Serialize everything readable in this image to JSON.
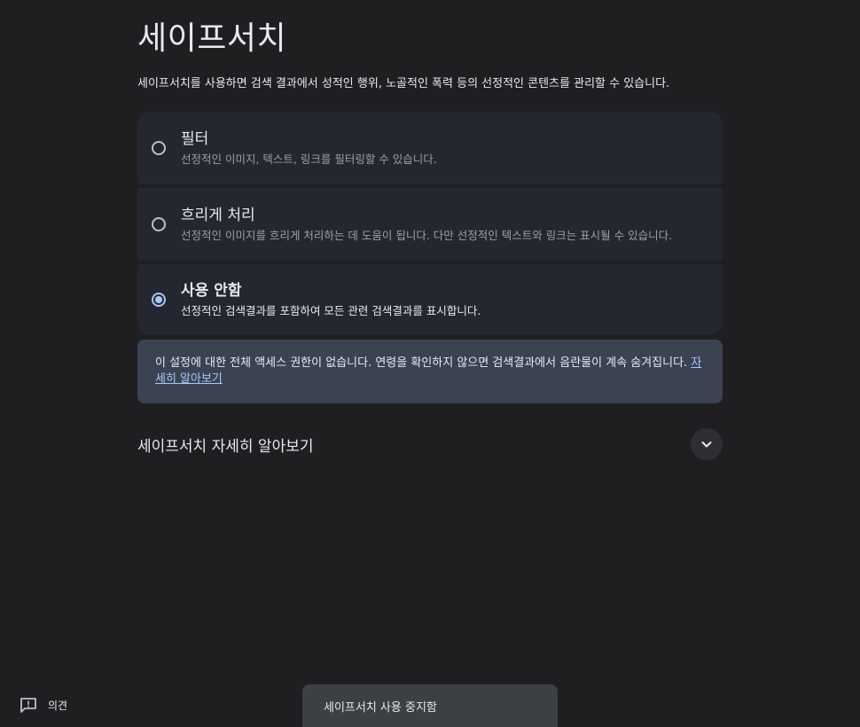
{
  "page": {
    "title": "세이프서치",
    "description": "세이프서치를 사용하면 검색 결과에서 성적인 행위, 노골적인 폭력 등의 선정적인 콘텐츠를 관리할 수 있습니다."
  },
  "options": [
    {
      "label": "필터",
      "description": "선정적인 이미지, 텍스트, 링크를 필터링할 수 있습니다.",
      "selected": false
    },
    {
      "label": "흐리게 처리",
      "description": "선정적인 이미지를 흐리게 처리하는 데 도움이 됩니다. 다만 선정적인 텍스트와 링크는 표시될 수 있습니다.",
      "selected": false
    },
    {
      "label": "사용 안함",
      "description": "선정적인 검색결과를 포함하여 모든 관련 검색결과를 표시합니다.",
      "selected": true
    }
  ],
  "notice": {
    "text": "이 설정에 대한 전체 액세스 권한이 없습니다. 연령을 확인하지 않으면 검색결과에서 음란물이 계속 숨겨집니다. ",
    "link": "자세히 알아보기"
  },
  "learn_more": {
    "title": "세이프서치 자세히 알아보기"
  },
  "feedback": {
    "label": "의견",
    "icon": "feedback-icon"
  },
  "toast": {
    "text": "세이프서치 사용 중지함"
  },
  "colors": {
    "background": "#1f1f22",
    "card": "#242730",
    "notice": "#3b4252",
    "accent": "#a8c7fa",
    "toast": "#3c4043"
  }
}
